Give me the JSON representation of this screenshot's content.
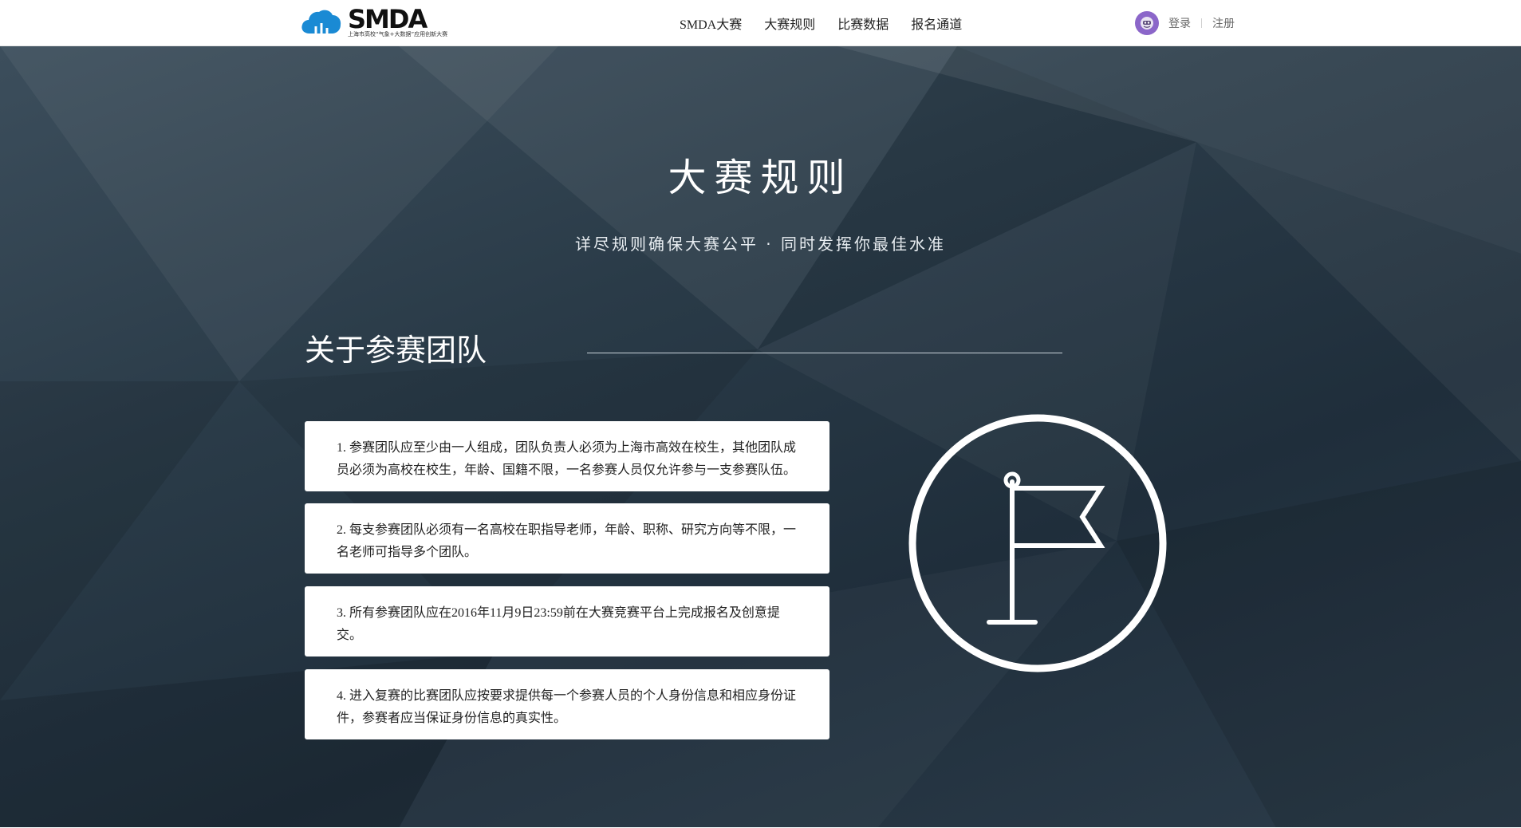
{
  "header": {
    "logo": {
      "text": "SMDA",
      "subtitle": "上海市高校“气象+大数据”应用创新大赛",
      "icon": "cloud-icon",
      "accent_color": "#1a8ad4"
    },
    "nav": [
      {
        "label": "SMDA大赛"
      },
      {
        "label": "大赛规则"
      },
      {
        "label": "比赛数据"
      },
      {
        "label": "报名通道"
      }
    ],
    "user": {
      "avatar_icon": "avatar-icon",
      "avatar_color": "#8b66c9",
      "login_label": "登录",
      "register_label": "注册"
    }
  },
  "hero": {
    "title": "大赛规则",
    "subtitle": "详尽规则确保大赛公平 · 同时发挥你最佳水准",
    "background_color": "#26394a"
  },
  "section": {
    "title": "关于参赛团队",
    "rules": [
      {
        "text": "1. 参赛团队应至少由一人组成，团队负责人必须为上海市高效在校生，其他团队成员必须为高校在校生，年龄、国籍不限，一名参赛人员仅允许参与一支参赛队伍。"
      },
      {
        "text": "2. 每支参赛团队必须有一名高校在职指导老师，年龄、职称、研究方向等不限，一名老师可指导多个团队。"
      },
      {
        "text": "3. 所有参赛团队应在2016年11月9日23:59前在大赛竞赛平台上完成报名及创意提交。"
      },
      {
        "text": "4. 进入复赛的比赛团队应按要求提供每一个参赛人员的个人身份信息和相应身份证件，参赛者应当保证身份信息的真实性。"
      }
    ],
    "illustration_icon": "flag-icon"
  }
}
